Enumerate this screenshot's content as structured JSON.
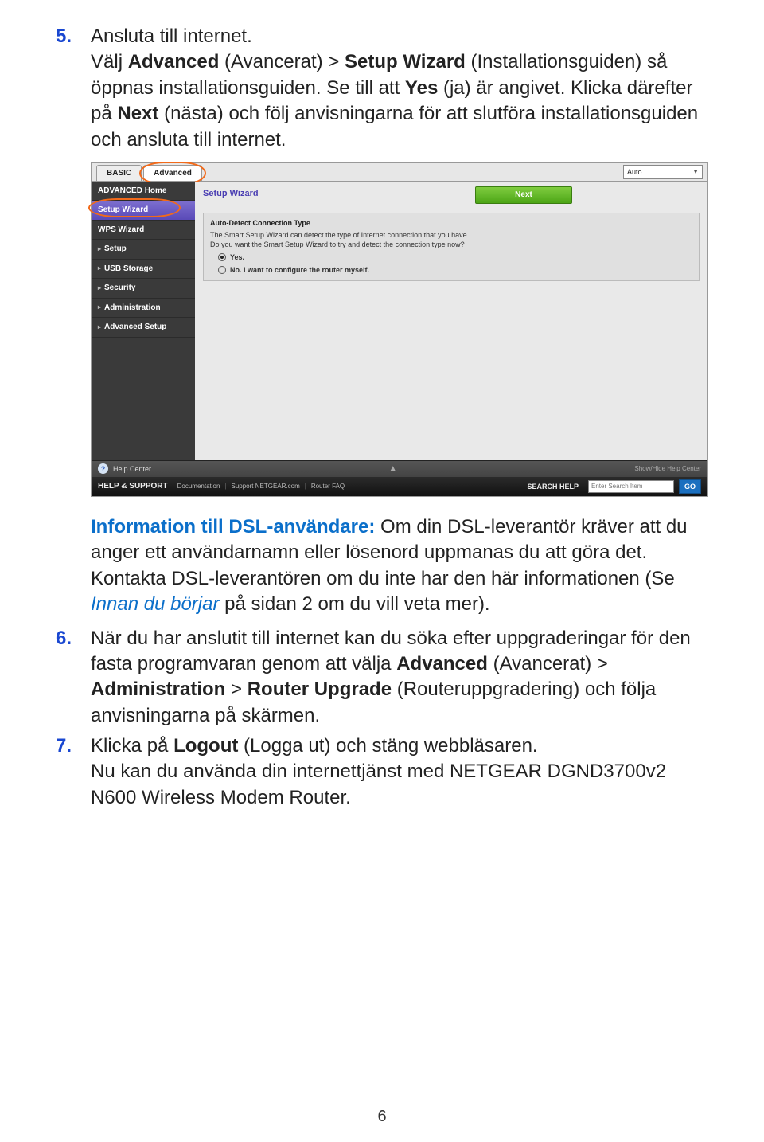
{
  "steps": {
    "s5": {
      "num": "5.",
      "title": "Ansluta till internet.",
      "p1a": "Välj ",
      "p1b": "Advanced",
      "p1c": " (Avancerat) > ",
      "p1d": "Setup Wizard",
      "p1e": " (Installationsguiden) så öppnas installationsguiden. Se till att ",
      "p1f": "Yes",
      "p1g": " (ja) är angivet. Klicka därefter på ",
      "p1h": "Next",
      "p1i": " (nästa) och följ anvisningarna för att slutföra installationsguiden och ansluta till internet."
    },
    "note": {
      "heading": "Information till DSL-användare:",
      "b1": " Om din DSL-leverantör kräver att du anger ett användarnamn eller lösenord uppmanas du att göra det. Kontakta DSL-leverantören om du inte har den här informationen (Se ",
      "link": "Innan du börjar",
      "b2": " på sidan 2 om du vill veta mer)."
    },
    "s6": {
      "num": "6.",
      "p1a": "När du har anslutit till internet kan du söka efter uppgraderingar för den fasta programvaran genom att välja ",
      "p1b": "Advanced",
      "p1c": " (Avancerat) > ",
      "p1d": "Administration",
      "p1e": " > ",
      "p1f": "Router Upgrade",
      "p1g": " (Routeruppgradering) och följa anvisningarna på skärmen."
    },
    "s7": {
      "num": "7.",
      "p1a": "Klicka på ",
      "p1b": "Logout",
      "p1c": " (Logga ut) och stäng webbläsaren.",
      "p2": "Nu kan du använda din internettjänst med NETGEAR DGND3700v2 N600 Wireless Modem Router."
    }
  },
  "router": {
    "tabs": {
      "basic": "BASIC",
      "advanced": "Advanced",
      "auto": "Auto"
    },
    "sidebar": {
      "home": "ADVANCED Home",
      "wizard": "Setup Wizard",
      "wps": "WPS Wizard",
      "setup": "Setup",
      "usb": "USB Storage",
      "security": "Security",
      "admin": "Administration",
      "advsetup": "Advanced Setup"
    },
    "content": {
      "title": "Setup Wizard",
      "next": "Next",
      "panel_title": "Auto-Detect Connection Type",
      "line1": "The Smart Setup Wizard can detect the type of Internet connection that you have.",
      "line2": "Do you want the Smart Setup Wizard to try and detect the connection type now?",
      "opt_yes": "Yes.",
      "opt_no": "No. I want to configure the router myself."
    },
    "helpbar": {
      "label": "Help Center",
      "toggle": "Show/Hide Help Center"
    },
    "support": {
      "label": "HELP & SUPPORT",
      "doc": "Documentation",
      "sup": "Support NETGEAR.com",
      "faq": "Router FAQ",
      "searchlabel": "SEARCH HELP",
      "placeholder": "Enter Search Item",
      "go": "GO"
    }
  },
  "pagenum": "6"
}
